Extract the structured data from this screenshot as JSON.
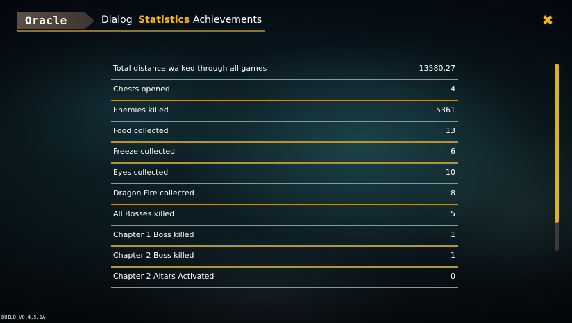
{
  "header": {
    "title": "Oracle",
    "tabs": [
      {
        "label": "Dialog"
      },
      {
        "label": "Statistics"
      },
      {
        "label": "Achievements"
      }
    ],
    "active_tab": "Statistics",
    "close_glyph": "✖"
  },
  "colors": {
    "accent": "#f5b614",
    "divider": "#b4952e"
  },
  "stats": [
    {
      "label": "Total distance walked through all games",
      "value": "13580,27"
    },
    {
      "label": "Chests opened",
      "value": "4"
    },
    {
      "label": "Enemies killed",
      "value": "5361"
    },
    {
      "label": "Food collected",
      "value": "13"
    },
    {
      "label": "Freeze collected",
      "value": "6"
    },
    {
      "label": "Eyes collected",
      "value": "10"
    },
    {
      "label": "Dragon Fire collected",
      "value": "8"
    },
    {
      "label": "All Bosses killed",
      "value": "5"
    },
    {
      "label": "Chapter 1 Boss killed",
      "value": "1"
    },
    {
      "label": "Chapter 2 Boss killed",
      "value": "1"
    },
    {
      "label": "Chapter 2 Altars Activated",
      "value": "0"
    }
  ],
  "footer": {
    "build": "BUILD V0.4.5.1A"
  }
}
